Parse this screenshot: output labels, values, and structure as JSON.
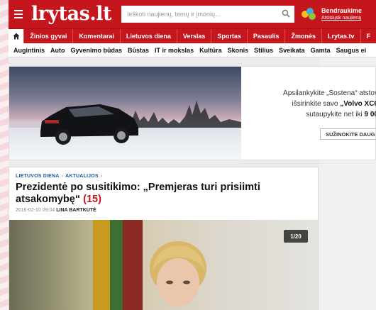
{
  "header": {
    "logo": "lrytas.lt",
    "search_placeholder": "Ieškoti naujienų, temų ir įmonių...",
    "community_title": "Bendraukime",
    "community_link": "Atsisiųsk naujieną",
    "brand_color": "#c4161c"
  },
  "mainnav": {
    "items": [
      "Žinios gyvai",
      "Komentarai",
      "Lietuvos diena",
      "Verslas",
      "Sportas",
      "Pasaulis",
      "Žmonės",
      "Lrytas.tv",
      "F"
    ]
  },
  "subnav": {
    "items": [
      "Augintinis",
      "Auto",
      "Gyvenimo būdas",
      "Būstas",
      "IT ir mokslas",
      "Kultūra",
      "Skonis",
      "Stilius",
      "Sveikata",
      "Gamta",
      "Saugus ei"
    ]
  },
  "ad": {
    "line1": "Apsilankykite „Sostena“ atstov",
    "line2_prefix": "išsirinkite savo ",
    "line2_bold": "„Volvo XC6",
    "line3_prefix": "sutaupykite net iki ",
    "line3_bold": "9 00",
    "button": "SUŽINOKITE DAUG"
  },
  "article": {
    "crumb1": "LIETUVOS DIENA",
    "crumb2": "AKTUALIJOS",
    "headline": "Prezidentė po susitikimo: „Premjeras turi prisiimti atsakomybę“",
    "comment_count": "(15)",
    "timestamp": "2016-02-10 09:04",
    "author": "LINA BARTKUTĖ",
    "gallery_counter": "1/20"
  }
}
